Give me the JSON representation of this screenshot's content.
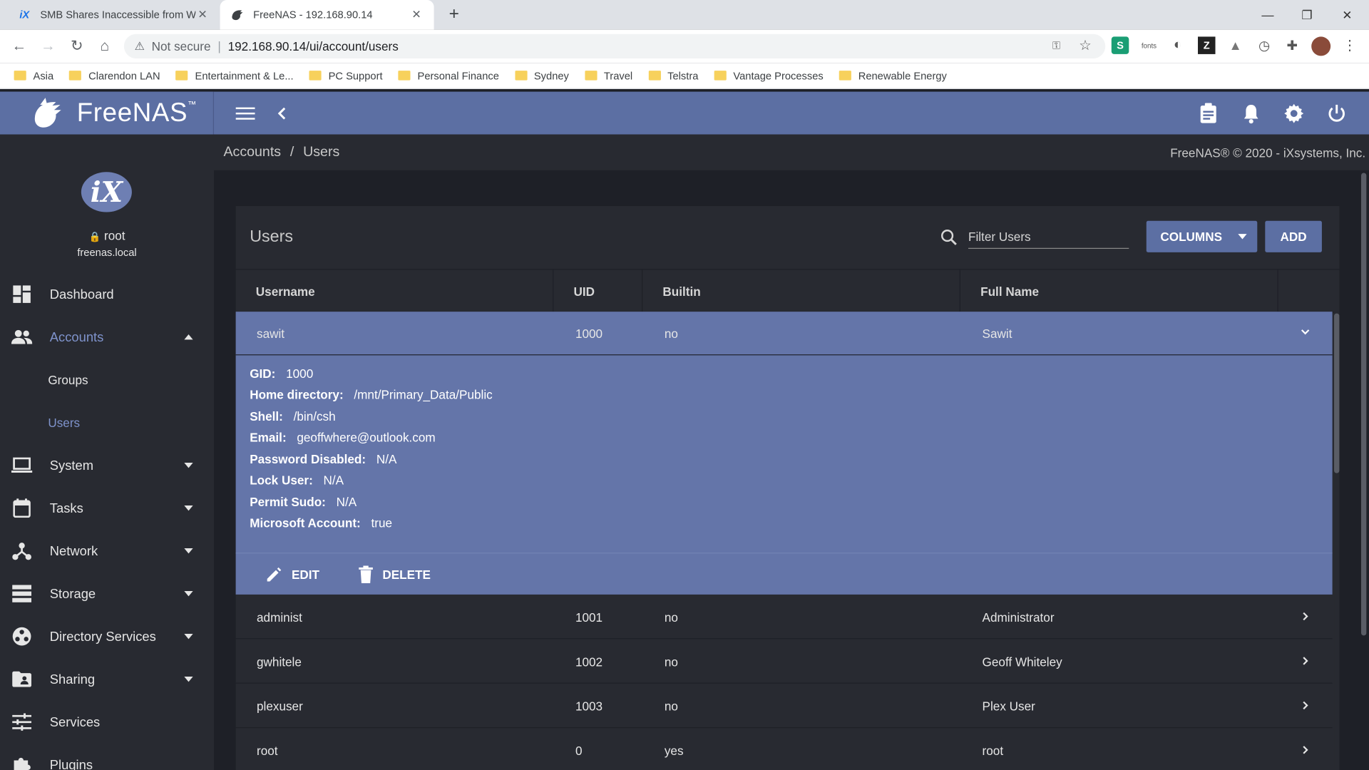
{
  "browser": {
    "tabs": [
      {
        "title": "SMB Shares Inaccessible from Wi",
        "icon": "ix-icon"
      },
      {
        "title": "FreeNAS - 192.168.90.14",
        "icon": "freenas-icon"
      }
    ],
    "not_secure": "Not secure",
    "url": "192.168.90.14/ui/account/users",
    "ext_fonts": "fonts",
    "bookmarks": [
      "Asia",
      "Clarendon LAN",
      "Entertainment & Le...",
      "PC Support",
      "Personal Finance",
      "Sydney",
      "Travel",
      "Telstra",
      "Vantage Processes",
      "Renewable Energy"
    ]
  },
  "app": {
    "logo_text": "FreeNAS",
    "logo_tm": "™",
    "avatar_text": "iX",
    "user": "root",
    "host": "freenas.local"
  },
  "sidebar": {
    "items": [
      {
        "label": "Dashboard"
      },
      {
        "label": "Accounts"
      },
      {
        "label": "System"
      },
      {
        "label": "Tasks"
      },
      {
        "label": "Network"
      },
      {
        "label": "Storage"
      },
      {
        "label": "Directory Services"
      },
      {
        "label": "Sharing"
      },
      {
        "label": "Services"
      },
      {
        "label": "Plugins"
      }
    ],
    "sub_items": [
      "Groups",
      "Users"
    ]
  },
  "breadcrumb": {
    "parent": "Accounts",
    "sep": "/",
    "current": "Users"
  },
  "copyright": "FreeNAS® © 2020 - iXsystems, Inc.",
  "card": {
    "title": "Users",
    "filter_placeholder": "Filter Users",
    "columns_label": "COLUMNS",
    "add_label": "ADD"
  },
  "table": {
    "headers": [
      "Username",
      "UID",
      "Builtin",
      "Full Name"
    ],
    "rows": [
      {
        "username": "sawit",
        "uid": "1000",
        "builtin": "no",
        "full_name": "Sawit"
      },
      {
        "username": "administ",
        "uid": "1001",
        "builtin": "no",
        "full_name": "Administrator"
      },
      {
        "username": "gwhitele",
        "uid": "1002",
        "builtin": "no",
        "full_name": "Geoff Whiteley"
      },
      {
        "username": "plexuser",
        "uid": "1003",
        "builtin": "no",
        "full_name": "Plex User"
      },
      {
        "username": "root",
        "uid": "0",
        "builtin": "yes",
        "full_name": "root"
      }
    ]
  },
  "detail": {
    "lines": [
      {
        "label": "GID:",
        "value": "1000"
      },
      {
        "label": "Home directory:",
        "value": "/mnt/Primary_Data/Public"
      },
      {
        "label": "Shell:",
        "value": "/bin/csh"
      },
      {
        "label": "Email:",
        "value": "geoffwhere@outlook.com"
      },
      {
        "label": "Password Disabled:",
        "value": "N/A"
      },
      {
        "label": "Lock User:",
        "value": "N/A"
      },
      {
        "label": "Permit Sudo:",
        "value": "N/A"
      },
      {
        "label": "Microsoft Account:",
        "value": "true"
      }
    ],
    "edit_label": "EDIT",
    "delete_label": "DELETE"
  },
  "colors": {
    "header": "#5c6fa3",
    "sidebar": "#282a31",
    "content": "#1e2027",
    "selected_row": "#6475a9",
    "active_nav": "#7f93cc"
  }
}
